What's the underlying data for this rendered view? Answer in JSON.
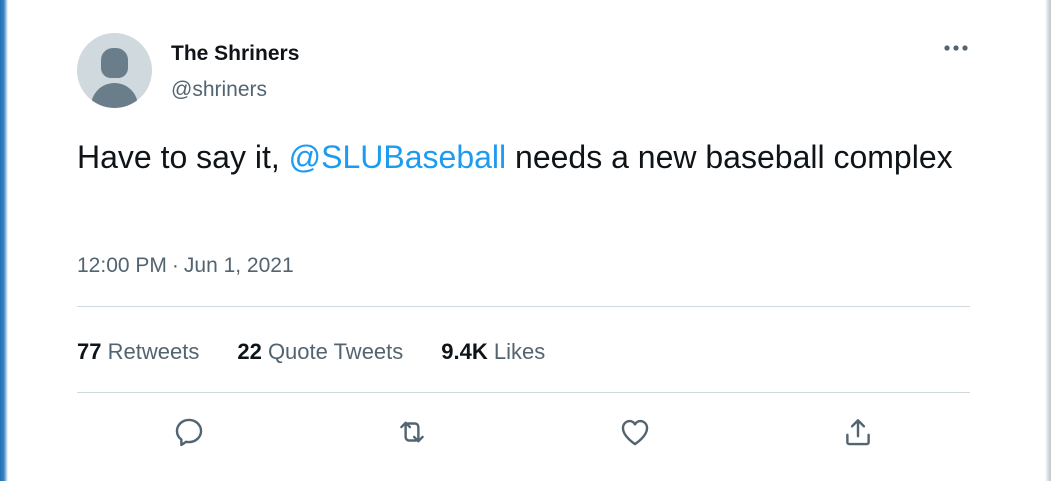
{
  "tweet": {
    "display_name": "The Shriners",
    "handle": "@shriners",
    "text_before": "Have to say it, ",
    "mention": "@SLUBaseball",
    "text_after": " needs a new baseball complex",
    "time": "12:00 PM",
    "separator": "·",
    "date": "Jun 1, 2021"
  },
  "stats": {
    "retweets_count": "77",
    "retweets_label": "Retweets",
    "quotes_count": "22",
    "quotes_label": "Quote Tweets",
    "likes_count": "9.4K",
    "likes_label": "Likes"
  },
  "icons": {
    "more": "more-horizontal-icon",
    "reply": "reply-icon",
    "retweet": "retweet-icon",
    "like": "heart-icon",
    "share": "share-icon"
  },
  "colors": {
    "text_primary": "#0f1419",
    "text_secondary": "#536471",
    "link": "#1d9bf0",
    "divider": "#cfd9de"
  }
}
